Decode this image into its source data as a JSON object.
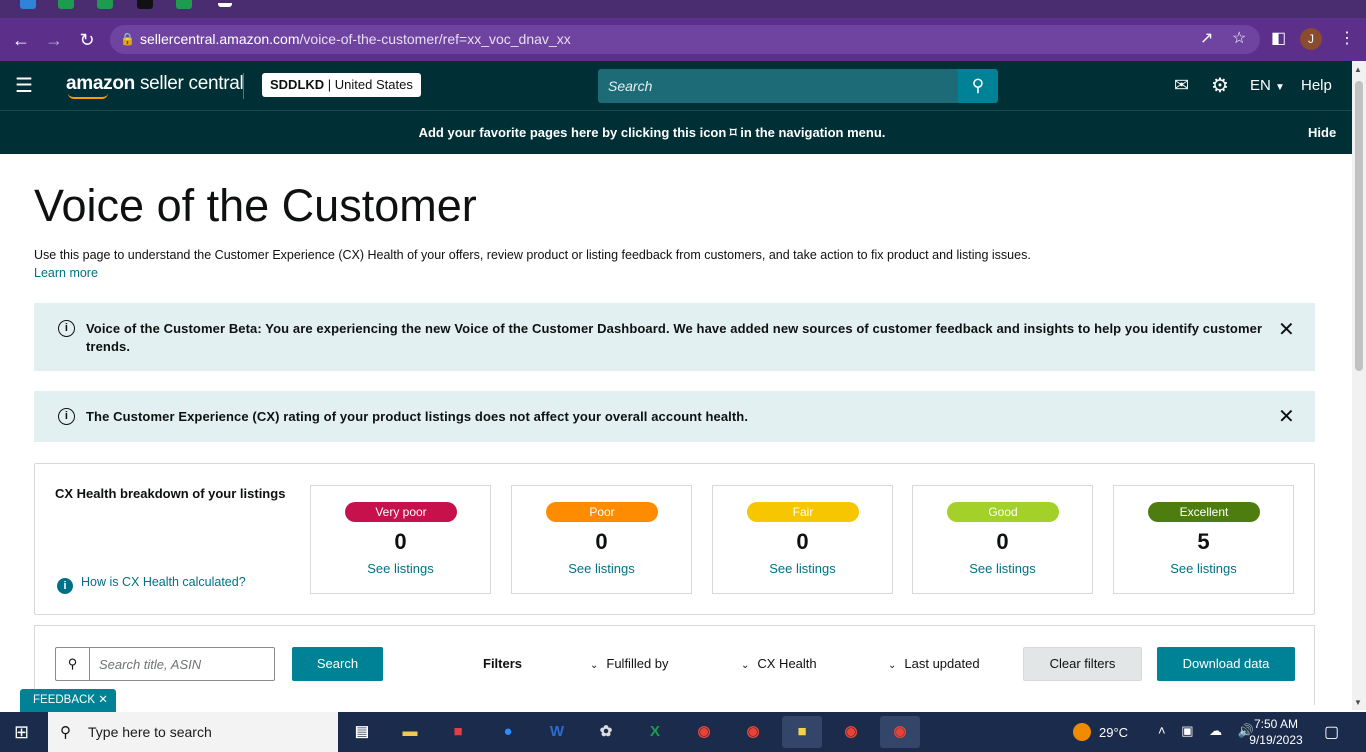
{
  "browser": {
    "url_host": "sellercentral.amazon.com",
    "url_path": "/voice-of-the-customer/ref=xx_voc_dnav_xx",
    "profile_initial": "J"
  },
  "header": {
    "logo_brand": "amazon",
    "logo_product": "seller central",
    "store_name": "SDDLKD",
    "store_region": "United States",
    "search_placeholder": "Search",
    "language": "EN",
    "help_label": "Help"
  },
  "favorites_bar": {
    "message": "Add your favorite pages here by clicking this icon ⌑ in the navigation menu.",
    "hide_label": "Hide"
  },
  "page": {
    "title": "Voice of the Customer",
    "description": "Use this page to understand the Customer Experience (CX) Health of your offers, review product or listing feedback from customers, and take action to fix product and listing issues.",
    "learn_more": "Learn more"
  },
  "alerts": [
    {
      "text": "Voice of the Customer Beta: You are experiencing the new Voice of the Customer Dashboard. We have added new sources of customer feedback and insights to help you identify customer trends."
    },
    {
      "text": "The Customer Experience (CX) rating of your product listings does not affect your overall account health."
    }
  ],
  "cx_health": {
    "title": "CX Health breakdown of your listings",
    "how_link": "How is CX Health calculated?",
    "cards": [
      {
        "label": "Very poor",
        "count": "0",
        "link": "See listings",
        "color": "#c7114d"
      },
      {
        "label": "Poor",
        "count": "0",
        "link": "See listings",
        "color": "#ff8c00"
      },
      {
        "label": "Fair",
        "count": "0",
        "link": "See listings",
        "color": "#f6c600"
      },
      {
        "label": "Good",
        "count": "0",
        "link": "See listings",
        "color": "#a3d12a"
      },
      {
        "label": "Excellent",
        "count": "5",
        "link": "See listings",
        "color": "#4e7d0f"
      }
    ]
  },
  "filters": {
    "search_placeholder": "Search title, ASIN",
    "search_button": "Search",
    "filters_label": "Filters",
    "fulfilled_by": "Fulfilled by",
    "cx_health": "CX Health",
    "last_updated": "Last updated",
    "clear_button": "Clear filters",
    "download_button": "Download data"
  },
  "feedback_tab": "FEEDBACK",
  "taskbar": {
    "search_placeholder": "Type here to search",
    "temperature": "29°C",
    "time": "7:50 AM",
    "date": "9/19/2023"
  }
}
